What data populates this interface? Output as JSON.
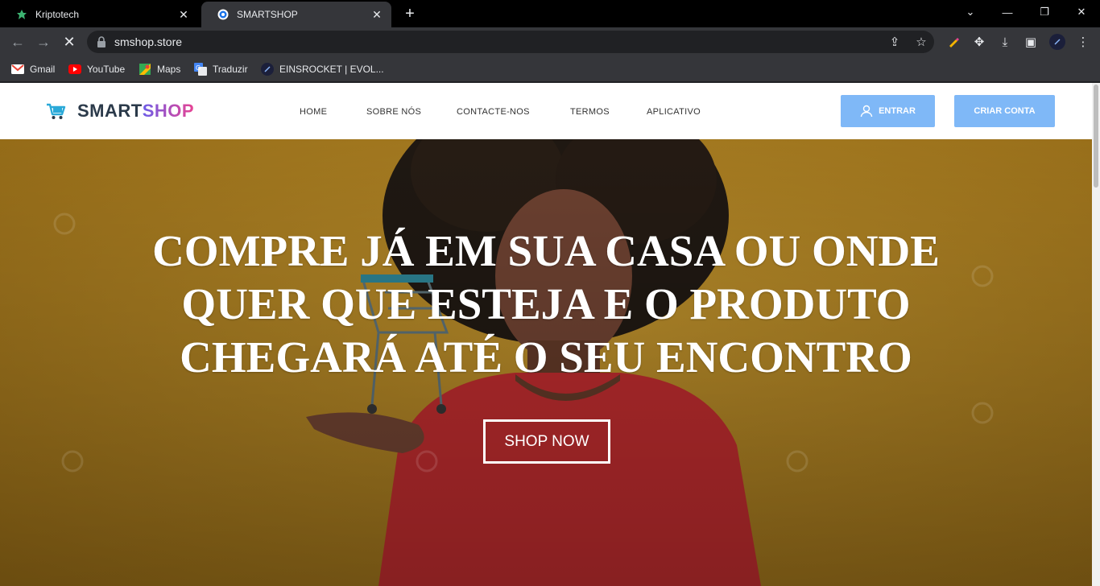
{
  "browser": {
    "tabs": [
      {
        "title": "Kriptotech",
        "active": false,
        "favicon": "leaf-icon"
      },
      {
        "title": "SMARTSHOP",
        "active": true,
        "favicon": "globe-icon"
      }
    ],
    "url": "smshop.store",
    "bookmarks": [
      {
        "label": "Gmail",
        "icon": "gmail-icon"
      },
      {
        "label": "YouTube",
        "icon": "youtube-icon"
      },
      {
        "label": "Maps",
        "icon": "maps-icon"
      },
      {
        "label": "Traduzir",
        "icon": "translate-icon"
      },
      {
        "label": "EINSROCKET | EVOL...",
        "icon": "rocket-icon"
      }
    ]
  },
  "site": {
    "brand_part1": "SMART",
    "brand_part2": "SHOP",
    "nav": [
      "HOME",
      "SOBRE NÓS",
      "CONTACTE-NOS",
      "TERMOS",
      "APLICATIVO"
    ],
    "login_label": "ENTRAR",
    "signup_label": "CRIAR CONTA",
    "hero": {
      "line1": "COMPRE JÁ EM SUA CASA OU ONDE",
      "line2": "QUER QUE ESTEJA E O PRODUTO",
      "line3": "CHEGARÁ ATÉ O SEU ENCONTRO",
      "button": "SHOP NOW"
    }
  },
  "colors": {
    "accent_button": "#7fb8f7",
    "hero_bg": "#a7791e",
    "brand_dark": "#2b3a4a"
  }
}
